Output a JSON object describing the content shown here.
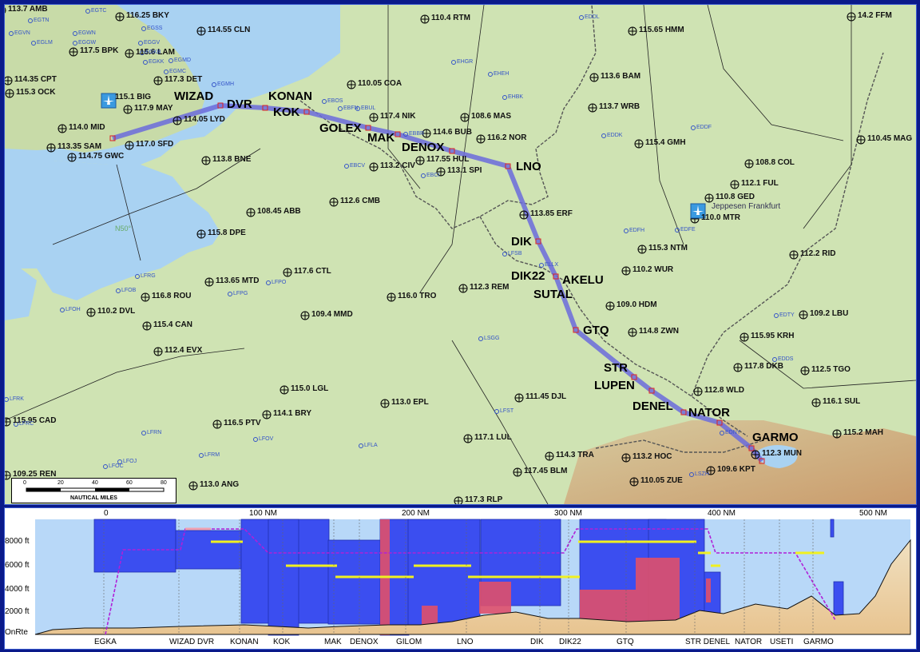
{
  "map": {
    "airport_name": "Jeppesen Frankfurt",
    "scale": {
      "ticks": [
        "0",
        "20",
        "40",
        "60",
        "80"
      ],
      "caption": "NAUTICAL MILES"
    },
    "graticule_label": "N50°",
    "route_waypoints": [
      "WIZAD",
      "DVR",
      "KONAN",
      "KOK",
      "GOLEX",
      "MAK",
      "DENOX",
      "LNO",
      "DIK",
      "DIK22",
      "AKELU",
      "SUTAL",
      "GTQ",
      "STR",
      "LUPEN",
      "DENEL",
      "NATOR",
      "GARMO"
    ],
    "navaids": [
      "116.25 BKY",
      "114.55 CLN",
      "117.5 BPK",
      "115.6 LAM",
      "114.35 CPT",
      "115.3 OCK",
      "115.1 BIG",
      "117.3 DET",
      "117.9 MAY",
      "114.05 LYD",
      "114.0 MID",
      "113.35 SAM",
      "117.0 SFD",
      "114.75 GWC",
      "113.8 BNE",
      "115.8 DPE",
      "108.45 ABB",
      "112.6 CMB",
      "113.2 CIV",
      "113.1 SPI",
      "117.55 HUL",
      "114.6 BUB",
      "117.4 NIK",
      "110.05 COA",
      "110.4 RTM",
      "108.6 MAS",
      "116.2 NOR",
      "115.65 HMM",
      "113.6 BAM",
      "113.7 WRB",
      "115.4 GMH",
      "108.8 COL",
      "112.1 FUL",
      "110.8 GED",
      "110.0 MTR",
      "14.2 FFM",
      "110.45 MAG",
      "113.85 ERF",
      "115.3 NTM",
      "112.2 RID",
      "110.2 WUR",
      "109.0 HDM",
      "114.8 ZWN",
      "115.95 KRH",
      "109.2 LBU",
      "117.8 DKB",
      "112.5 TGO",
      "112.8 WLD",
      "116.1 SUL",
      "115.2 MAH",
      "112.3 MUN",
      "109.6 KPT",
      "110.05 ZUE",
      "113.2 HOC",
      "114.3 TRA",
      "117.45 BLM",
      "117.1 LUL",
      "117.3 RLP",
      "111.45 DJL",
      "113.0 EPL",
      "116.0 TRO",
      "112.3 REM",
      "109.4 MMD",
      "117.6 CTL",
      "113.65 MTD",
      "116.8 ROU",
      "110.2 DVL",
      "115.4 CAN",
      "112.4 EVX",
      "115.0 LGL",
      "114.1 BRY",
      "116.5 PTV",
      "115.95 CAD",
      "109.25 REN",
      "113.0 ANG",
      "113.7 AMB"
    ],
    "airports": [
      "EGTC",
      "EGTN",
      "EGVN",
      "EGWN",
      "EGLM",
      "EGGW",
      "EGSS",
      "EGGV",
      "EGKB",
      "EGKK",
      "EGMD",
      "EGMC",
      "EGMH",
      "EBFN",
      "EBOS",
      "EBUL",
      "EBBR",
      "EBCI",
      "EBCV",
      "EHGR",
      "EHEH",
      "EHBK",
      "ELLX",
      "EDDK",
      "EDDL",
      "EDFE",
      "EDFH",
      "EDDF",
      "EDTY",
      "EDDS",
      "EDNY",
      "LSZH",
      "LSGG",
      "LFST",
      "LFSB",
      "LFPG",
      "LFPO",
      "LFOB",
      "LFRG",
      "LFOH",
      "LFRK",
      "LFRC",
      "LFRN",
      "LFOV",
      "LFRM",
      "LFOJ",
      "LFOC",
      "LFLA"
    ]
  },
  "profile": {
    "distance_labels": [
      "0",
      "100 NM",
      "200 NM",
      "300 NM",
      "400 NM",
      "500 NM"
    ],
    "altitude_labels": [
      "8000 ft",
      "6000 ft",
      "4000 ft",
      "2000 ft",
      "OnRte"
    ],
    "waypoint_labels": [
      "EGKA",
      "WIZAD DVR",
      "KONAN",
      "KOK",
      "MAK",
      "DENOX",
      "GILOM",
      "LNO",
      "DIK",
      "DIK22",
      "GTQ",
      "STR DENEL",
      "NATOR",
      "USETI",
      "GARMO"
    ]
  },
  "colors": {
    "sea": "#a9d2f2",
    "land": "#cfe3b3",
    "route": "#6b6bdc",
    "airspace_blue": "#3b4ef0",
    "airspace_red": "#e0506a",
    "altitude_line": "#b020d8",
    "level_marker": "#f0f020"
  }
}
